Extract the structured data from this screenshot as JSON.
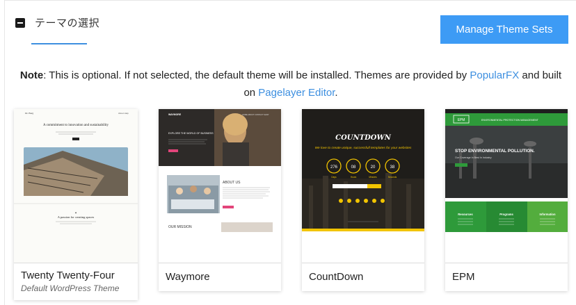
{
  "header": {
    "title": "テーマの選択",
    "manage_button": "Manage Theme Sets"
  },
  "note": {
    "label": "Note",
    "text_before": ": This is optional. If not selected, the default theme will be installed. Themes are provided by ",
    "link1": "PopularFX",
    "text_middle": " and built on ",
    "link2": "Pagelayer Editor",
    "text_after": "."
  },
  "themes": [
    {
      "name": "Twenty Twenty-Four",
      "subtitle": "Default WordPress Theme",
      "preview": {
        "brand": "Dr. Burg",
        "menu": "About Help",
        "headline": "A commitment to innovation and sustainability",
        "section": "A passion for creating spaces"
      }
    },
    {
      "name": "Waymore",
      "preview": {
        "brand": "WAYMORE",
        "hero": "EXPLORE THE WORLD OF BUSINESS",
        "about": "ABOUT US",
        "mission": "OUR MISSION"
      }
    },
    {
      "name": "CountDown",
      "preview": {
        "title": "COUNTDOWN",
        "tagline": "We love to create unique, successfull templates for your websites",
        "units": [
          {
            "value": "276",
            "label": "Days"
          },
          {
            "value": "08",
            "label": "Hours"
          },
          {
            "value": "20",
            "label": "Minutes"
          },
          {
            "value": "38",
            "label": "Seconds"
          }
        ]
      }
    },
    {
      "name": "EPM",
      "preview": {
        "brand": "EPM",
        "bar": "ENVIRONMENTAL PROTECTION MANAGEMENT",
        "hero": "STOP ENVIRONMENTAL POLLUTION.",
        "hero_sub": "Our Coverage In Best In Industry",
        "cols": [
          "Resources",
          "Programs",
          "Information"
        ]
      }
    }
  ],
  "colors": {
    "accent": "#3d9bf5",
    "link": "#3d8fe0",
    "countdown_yellow": "#f2c400",
    "epm_green": "#2e9a3a"
  }
}
